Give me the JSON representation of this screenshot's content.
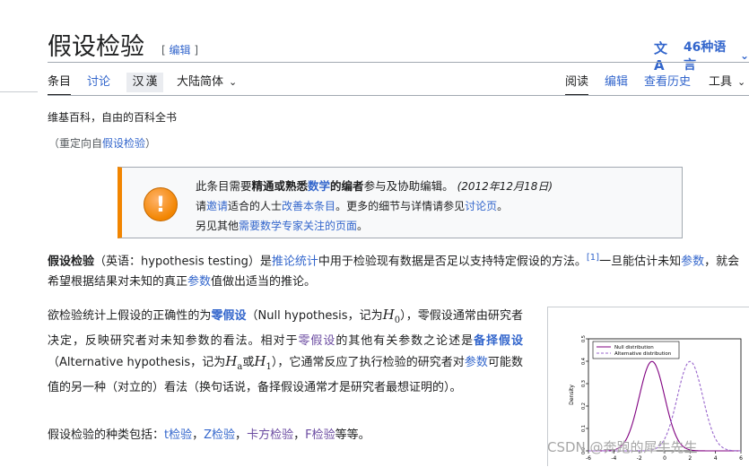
{
  "page": {
    "title": "假设检验",
    "edit_open": "[",
    "edit_label": "编辑",
    "edit_close": "]",
    "language_count": "46种语言"
  },
  "tabs": {
    "article": "条目",
    "talk": "讨论",
    "variant_a": "汉",
    "variant_b": "漢",
    "dialect": "大陆简体",
    "read": "阅读",
    "edit": "编辑",
    "history": "查看历史",
    "tools": "工具"
  },
  "tagline": "维基百科，自由的百科全书",
  "redirect": {
    "prefix": "（重定向自",
    "link": "假设检验",
    "suffix": "）"
  },
  "notice": {
    "l1_a": "此条目需要",
    "l1_b": "精通或熟悉",
    "l1_link": "数学",
    "l1_c": "的编者",
    "l1_d": "参与及协助编辑。",
    "date": "(2012年12月18日)",
    "l2_a": "请",
    "l2_link1": "邀请",
    "l2_b": "适合的人士",
    "l2_link2": "改善本条目",
    "l2_c": "。更多的细节与详情请参见",
    "l2_link3": "讨论页",
    "l2_d": "。",
    "l3_a": "另见其他",
    "l3_link": "需要数学专家关注的页面",
    "l3_b": "。"
  },
  "para1": {
    "term": "假设检验",
    "a": "（英语：hypothesis testing）是",
    "link1": "推论统计",
    "b": "中用于检验现有数据是否足以支持特定假设的方法。",
    "ref": "[1]",
    "c": "一旦能估计未知",
    "link2": "参数",
    "d": "，就会希望根据结果对未知的真正",
    "link3": "参数",
    "e": "值做出适当的推论。"
  },
  "para2": {
    "a": "欲检验统计上假设的正确性的为",
    "link1": "零假设",
    "b": "（Null hypothesis，记为",
    "h0": "H",
    "h0_sub": "0",
    "c": "），零假设通常由研究者决定，反映研究者对未知参数的看法。相对于",
    "link2": "零假设",
    "d": "的其他有关参数之论述是",
    "link3": "备择假设",
    "e": "（Alternative hypothesis，记为",
    "ha": "H",
    "ha_sub": "a",
    "or": "或",
    "h1": "H",
    "h1_sub": "1",
    "f": "），它通常反应了执行检验的研究者对",
    "link4": "参数",
    "g": "可能数值的另一种（对立的）看法（换句话说，备择假设通常才是研究者最想证明的）。"
  },
  "para3": {
    "a": "假设检验的种类包括：",
    "t": "t检验",
    "sep": "，",
    "z": "Z检验",
    "chi": "卡方检验",
    "f": "F检验",
    "end": "等等。"
  },
  "watermark": "CSDN @奔跑的犀牛先生",
  "colors": {
    "link": "#3366cc",
    "visited": "#6b4ba1",
    "notice_bar": "#f28500",
    "null_curve": "#800080",
    "alt_curve": "#9966cc"
  },
  "icons": [
    "translate-icon",
    "chevron-down-icon",
    "exclamation-icon"
  ],
  "chart_data": {
    "type": "line",
    "title": "",
    "xlabel": "",
    "ylabel": "Density",
    "xlim": [
      -6,
      6
    ],
    "ylim": [
      0,
      0.5
    ],
    "xticks": [
      "-6",
      "-4",
      "-2",
      "0",
      "2",
      "4",
      "6"
    ],
    "yticks": [
      "0.0",
      "0.1",
      "0.2",
      "0.3",
      "0.4",
      "0.5"
    ],
    "legend_position": "top-left",
    "series": [
      {
        "name": "Null distribution",
        "mean": -1,
        "sd": 1,
        "style": "solid",
        "color": "#800080"
      },
      {
        "name": "Alternative distribution",
        "mean": 2,
        "sd": 1,
        "style": "dashed",
        "color": "#9966cc"
      }
    ]
  }
}
